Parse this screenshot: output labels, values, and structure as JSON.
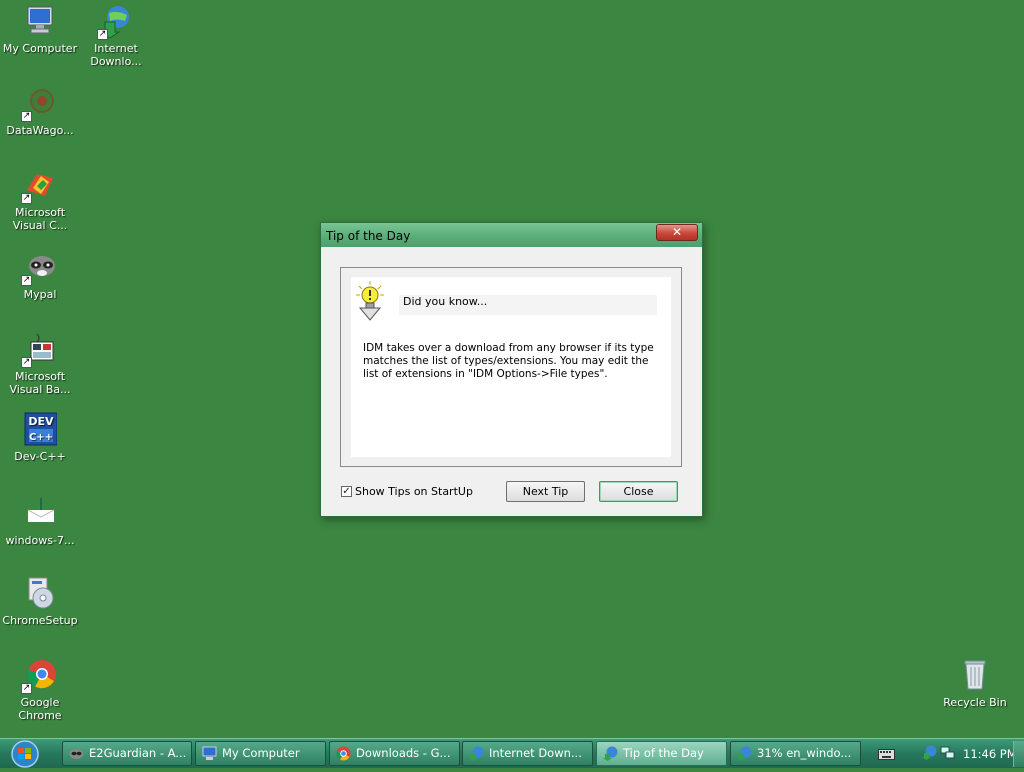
{
  "desktop": {
    "icons": [
      {
        "label": "My Computer"
      },
      {
        "label": "Internet\nDownlo..."
      },
      {
        "label": "DataWago..."
      },
      {
        "label": "Microsoft\nVisual C..."
      },
      {
        "label": "Mypal"
      },
      {
        "label": "Microsoft\nVisual Ba..."
      },
      {
        "label": "Dev-C++"
      },
      {
        "label": "windows-7..."
      },
      {
        "label": "ChromeSetup"
      },
      {
        "label": "Google\nChrome"
      },
      {
        "label": "Recycle Bin"
      }
    ]
  },
  "dialog": {
    "title": "Tip of the Day",
    "close_glyph": "✕",
    "heading": "Did you know...",
    "tip_text": "IDM takes over a download from any browser if its type matches the list of types/extensions. You may edit the list of extensions in \"IDM Options->File types\".",
    "show_tips_label": "Show Tips on StartUp",
    "show_tips_checked": true,
    "next_button": "Next Tip",
    "close_button": "Close"
  },
  "taskbar": {
    "items": [
      {
        "label": "E2Guardian - A...",
        "active": false
      },
      {
        "label": "My Computer",
        "active": false
      },
      {
        "label": "Downloads - G...",
        "active": false
      },
      {
        "label": "Internet Down...",
        "active": false
      },
      {
        "label": "Tip of the Day",
        "active": true
      },
      {
        "label": "31% en_windo...",
        "active": false
      }
    ],
    "clock": "11:46 PM"
  },
  "colors": {
    "desktop_bg": "#3b8640",
    "titlebar": "#5aae78",
    "taskbar": "#26785c",
    "close_button_red": "#c8483a"
  }
}
